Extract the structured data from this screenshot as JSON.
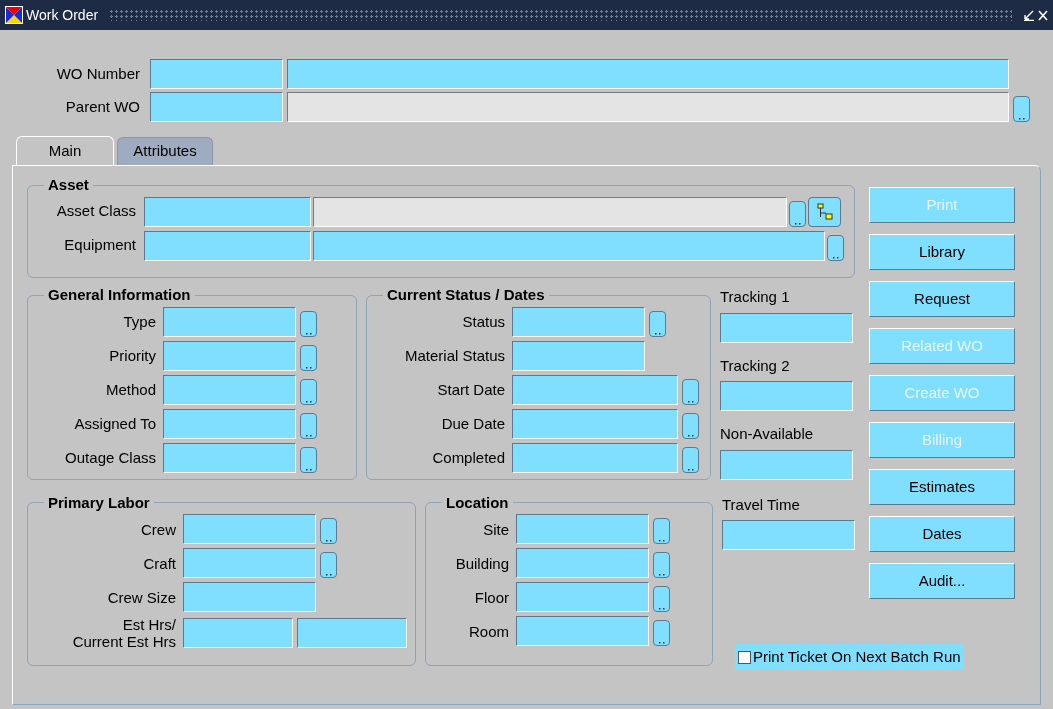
{
  "window": {
    "title": "Work Order"
  },
  "header_fields": [
    {
      "label": "WO Number",
      "second_disabled": false,
      "lov": false
    },
    {
      "label": "Parent WO",
      "second_disabled": true,
      "lov": true
    }
  ],
  "tabs": [
    {
      "label": "Main",
      "selected": true
    },
    {
      "label": "Attributes",
      "selected": false
    }
  ],
  "asset": {
    "title": "Asset",
    "fields": [
      {
        "label": "Asset Class",
        "second_disabled": true,
        "hierarchy": true
      },
      {
        "label": "Equipment",
        "second_disabled": false,
        "hierarchy": false
      }
    ]
  },
  "general_information": {
    "title": "General Information",
    "fields": [
      {
        "label": "Type",
        "kind": "lov"
      },
      {
        "label": "Priority",
        "kind": "lov"
      },
      {
        "label": "Method",
        "kind": "lov"
      },
      {
        "label": "Assigned To",
        "kind": "lov"
      },
      {
        "label": "Outage Class",
        "kind": "lov"
      }
    ]
  },
  "current_status": {
    "title": "Current Status / Dates",
    "fields": [
      {
        "label": "Status",
        "kind": "lov"
      },
      {
        "label": "Material Status",
        "kind": "plain"
      },
      {
        "label": "Start Date",
        "kind": "date"
      },
      {
        "label": "Due Date",
        "kind": "date"
      },
      {
        "label": "Completed",
        "kind": "date"
      }
    ]
  },
  "tracking": [
    {
      "label": "Tracking 1"
    },
    {
      "label": "Tracking 2"
    },
    {
      "label": "Non-Available"
    },
    {
      "label": "Travel Time"
    }
  ],
  "primary_labor": {
    "title": "Primary Labor",
    "fields": [
      {
        "label": "Crew",
        "kind": "lov"
      },
      {
        "label": "Craft",
        "kind": "lov"
      },
      {
        "label": "Crew Size",
        "kind": "plain"
      },
      {
        "label": "Est Hrs/\nCurrent Est Hrs",
        "kind": "pair"
      }
    ]
  },
  "location": {
    "title": "Location",
    "fields": [
      {
        "label": "Site",
        "kind": "lov"
      },
      {
        "label": "Building",
        "kind": "lov"
      },
      {
        "label": "Floor",
        "kind": "lov"
      },
      {
        "label": "Room",
        "kind": "lov"
      }
    ]
  },
  "buttons": [
    {
      "label": "Print",
      "disabled": true
    },
    {
      "label": "Library",
      "disabled": false
    },
    {
      "label": "Request",
      "disabled": false
    },
    {
      "label": "Related WO",
      "disabled": true
    },
    {
      "label": "Create WO",
      "disabled": true
    },
    {
      "label": "Billing",
      "disabled": true
    },
    {
      "label": "Estimates",
      "disabled": false
    },
    {
      "label": "Dates",
      "disabled": false
    },
    {
      "label": "Audit...",
      "disabled": false
    }
  ],
  "print_ticket": {
    "label": "Print Ticket On Next Batch Run",
    "checked": false
  }
}
